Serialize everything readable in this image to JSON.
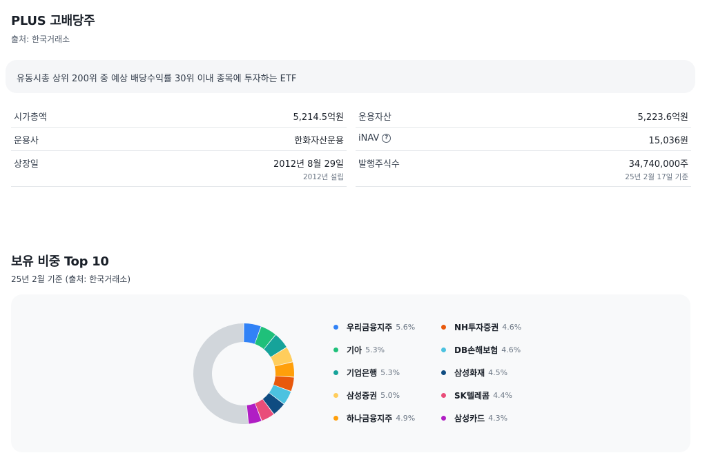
{
  "header": {
    "title": "PLUS 고배당주",
    "source": "출처: 한국거래소"
  },
  "description": "유동시총 상위 200위 중 예상 배당수익률 30위 이내 종목에 투자하는 ETF",
  "info": {
    "left": [
      {
        "label": "시가총액",
        "value": "5,214.5억원"
      },
      {
        "label": "운용사",
        "value": "한화자산운용"
      },
      {
        "label": "상장일",
        "value": "2012년 8월 29일",
        "sub": "2012년 설립"
      }
    ],
    "right": [
      {
        "label": "운용자산",
        "value": "5,223.6억원"
      },
      {
        "label": "iNAV",
        "value": "15,036원",
        "help_icon": "question-circle-icon"
      },
      {
        "label": "발행주식수",
        "value": "34,740,000주",
        "sub": "25년 2월 17일 기준"
      }
    ]
  },
  "holdings": {
    "title": "보유 비중 Top 10",
    "subtitle": "25년 2월 기준 (출처: 한국거래소)"
  },
  "chart_data": {
    "type": "pie",
    "donut": true,
    "categories": [
      "우리금융지주",
      "기아",
      "기업은행",
      "삼성증권",
      "하나금융지주",
      "NH투자증권",
      "DB손해보험",
      "삼성화재",
      "SK텔레콤",
      "삼성카드"
    ],
    "values": [
      5.6,
      5.3,
      5.3,
      5.0,
      4.9,
      4.6,
      4.6,
      4.5,
      4.4,
      4.3
    ],
    "labels": [
      "5.6%",
      "5.3%",
      "5.3%",
      "5.0%",
      "4.9%",
      "4.6%",
      "4.6%",
      "4.5%",
      "4.4%",
      "4.3%"
    ],
    "colors": [
      "#3182f6",
      "#1fc07a",
      "#16a39a",
      "#ffcd5c",
      "#ff9f0a",
      "#e8590c",
      "#4cc2e0",
      "#0f4c81",
      "#e94d79",
      "#b01ec4"
    ],
    "remainder_color": "#d1d6db",
    "legend": "right"
  }
}
